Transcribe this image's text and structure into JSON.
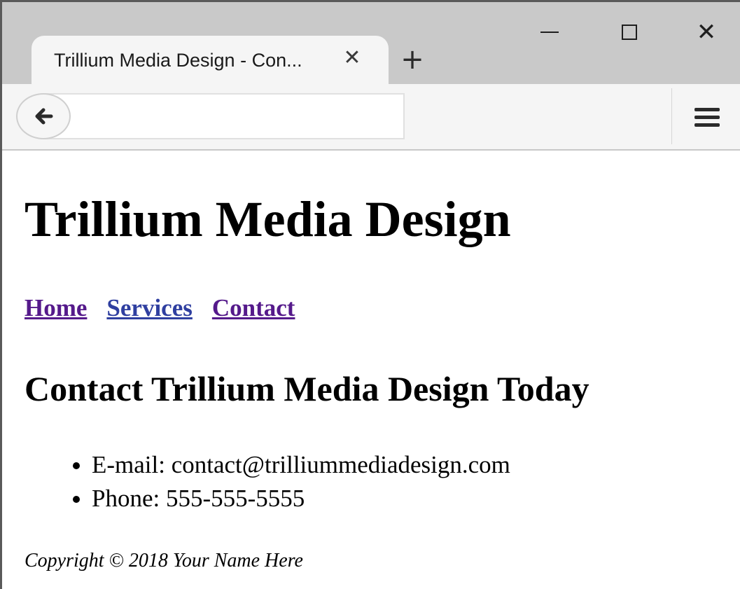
{
  "browser": {
    "tab": {
      "title": "Trillium Media Design - Con...",
      "close_icon": "close-icon"
    },
    "new_tab_icon": "plus-icon",
    "window_controls": {
      "minimize": "minimize-icon",
      "maximize": "maximize-icon",
      "close": "close-icon"
    },
    "toolbar": {
      "back_icon": "arrow-left-icon",
      "url": "",
      "menu_icon": "hamburger-menu-icon"
    }
  },
  "page": {
    "title": "Trillium Media Design",
    "nav": [
      {
        "label": "Home",
        "state": "visited"
      },
      {
        "label": "Services",
        "state": "link"
      },
      {
        "label": "Contact",
        "state": "visited"
      }
    ],
    "heading": "Contact Trillium Media Design Today",
    "contact": [
      "E-mail: contact@trilliummediadesign.com",
      "Phone: 555-555-5555"
    ],
    "footer": "Copyright © 2018 Your Name Here"
  },
  "colors": {
    "visited_link": "#551a8b",
    "link": "#2f3fa0",
    "tabstrip": "#c9c9c9",
    "toolbar": "#f5f5f5"
  }
}
